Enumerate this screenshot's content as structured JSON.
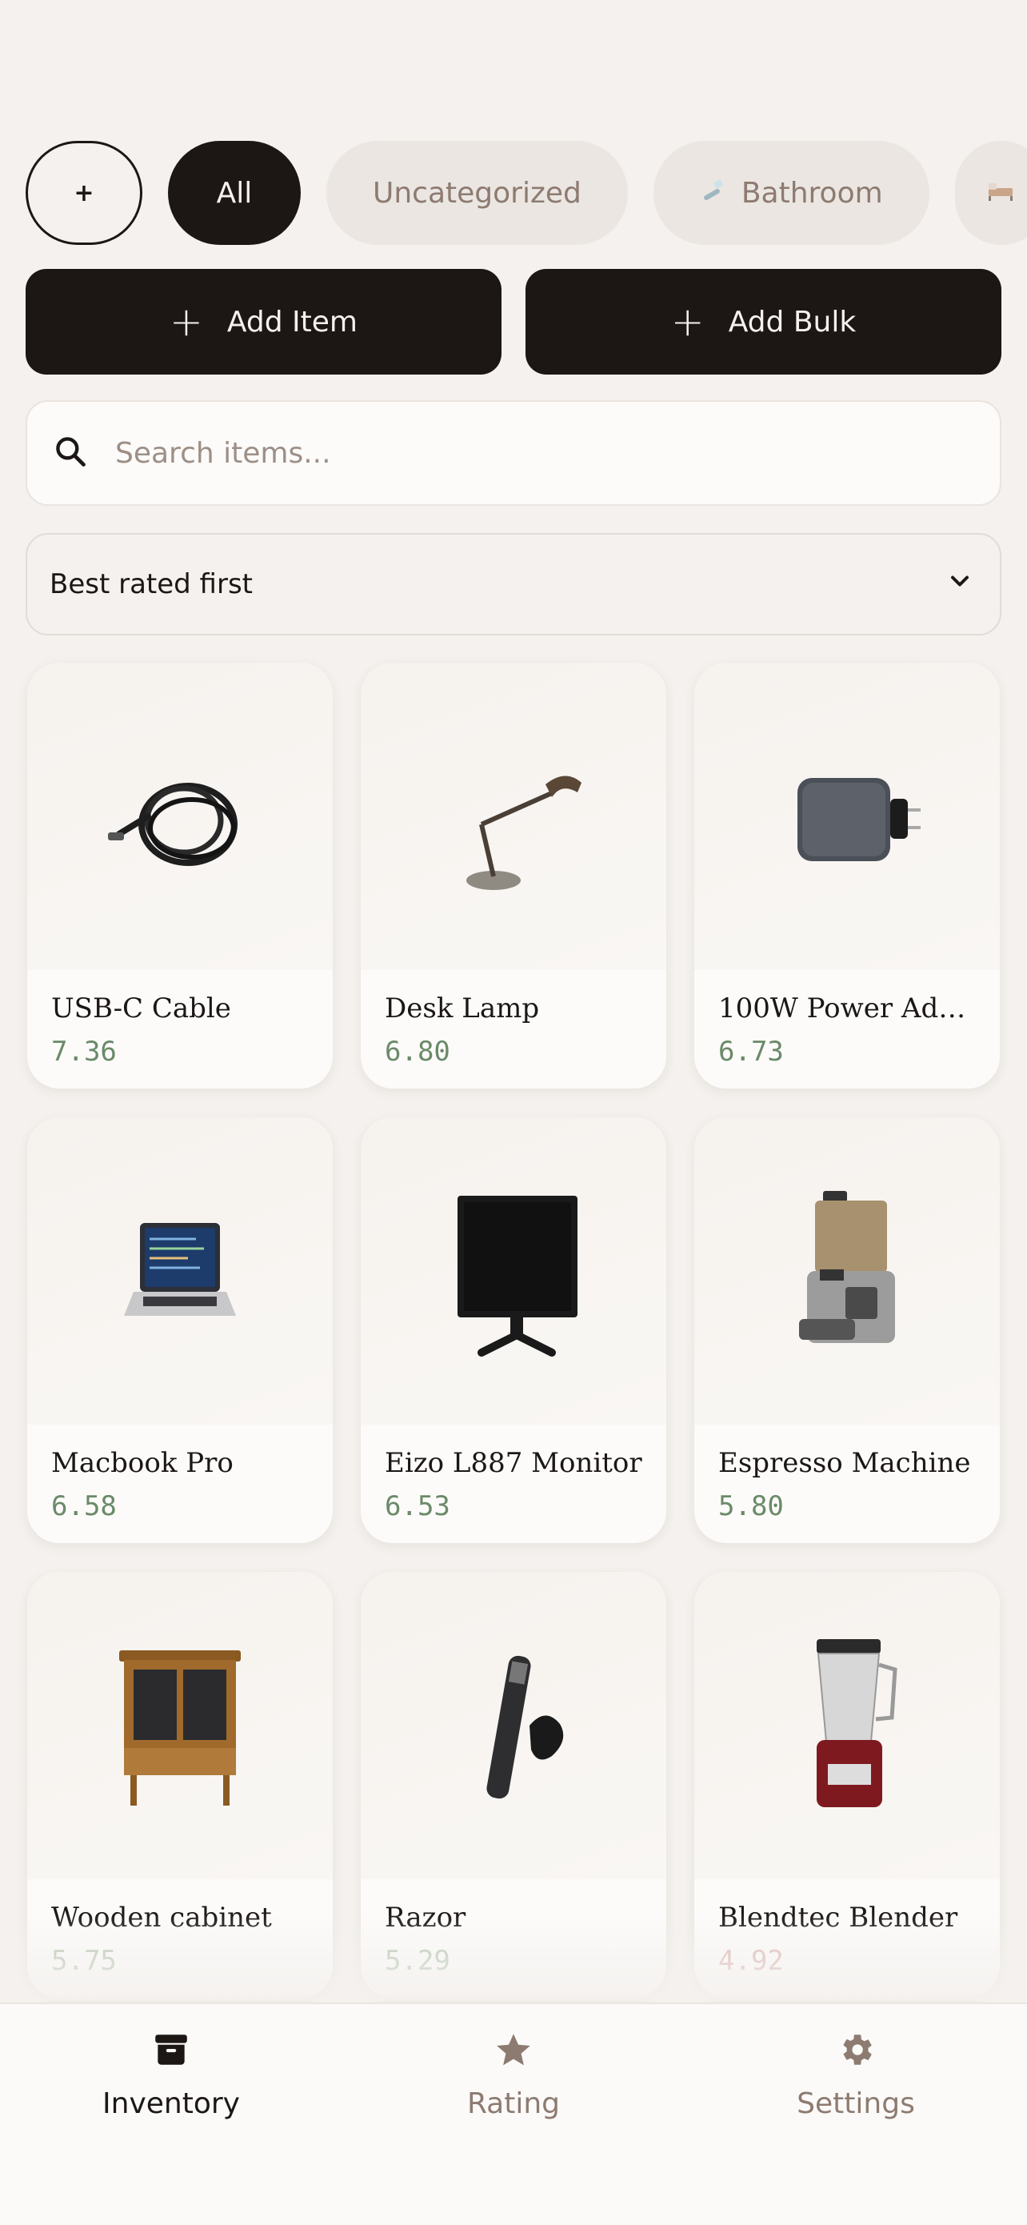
{
  "categories": {
    "add_label": "+",
    "items": [
      {
        "label": "All",
        "active": true
      },
      {
        "label": "Uncategorized",
        "active": false
      },
      {
        "label": "Bathroom",
        "icon": "toothbrush-icon",
        "active": false
      }
    ]
  },
  "actions": {
    "add_item": "Add Item",
    "add_bulk": "Add Bulk"
  },
  "search": {
    "placeholder": "Search items..."
  },
  "sort": {
    "selected": "Best rated first"
  },
  "items": [
    {
      "name": "USB-C Cable",
      "score": "7.36",
      "icon": "cable-icon"
    },
    {
      "name": "Desk Lamp",
      "score": "6.80",
      "icon": "lamp-icon"
    },
    {
      "name": "100W Power Ada...",
      "score": "6.73",
      "icon": "power-adapter-icon"
    },
    {
      "name": "Macbook Pro",
      "score": "6.58",
      "icon": "laptop-icon"
    },
    {
      "name": "Eizo L887 Monitor",
      "score": "6.53",
      "icon": "monitor-icon"
    },
    {
      "name": "Espresso Machine",
      "score": "5.80",
      "icon": "espresso-machine-icon"
    },
    {
      "name": "Wooden cabinet",
      "score": "5.75",
      "icon": "cabinet-icon"
    },
    {
      "name": "Razor",
      "score": "5.29",
      "icon": "razor-icon"
    },
    {
      "name": "Blendtec Blender",
      "score": "4.92",
      "icon": "blender-icon"
    }
  ],
  "nav": {
    "inventory": "Inventory",
    "rating": "Rating",
    "settings": "Settings",
    "active": "inventory"
  },
  "colors": {
    "background": "#f4f1ee",
    "primary": "#1c1715",
    "score_green": "#6b8a68",
    "muted": "#8d7b71"
  }
}
